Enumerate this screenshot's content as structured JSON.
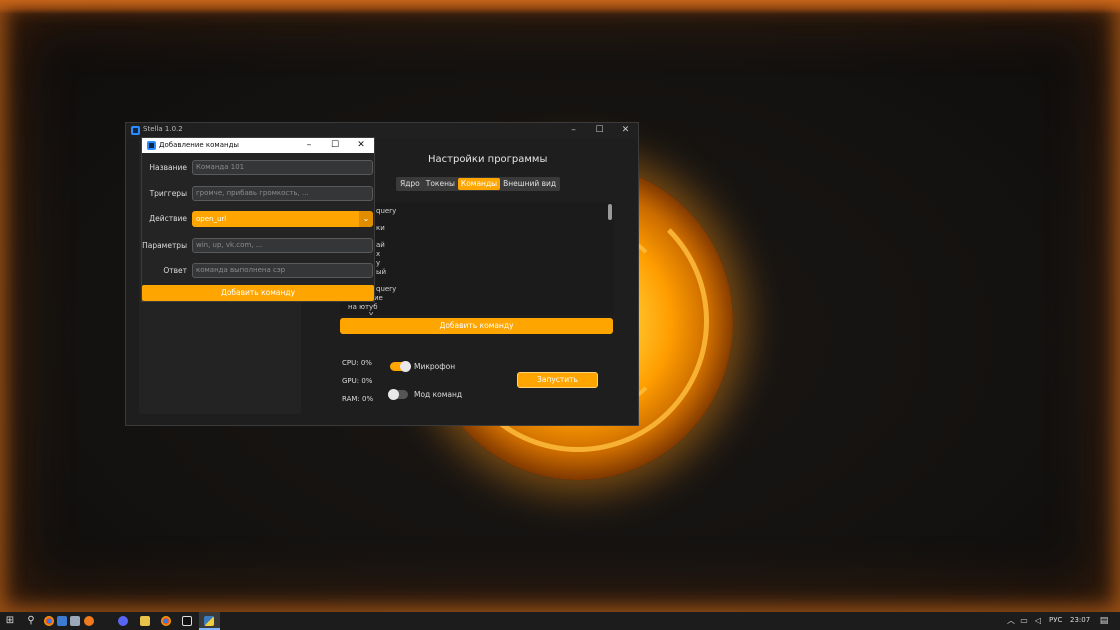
{
  "main_window": {
    "title": "Stella 1.0.2",
    "settings_title": "Настройки программы",
    "tabs": [
      {
        "label": "Ядро",
        "active": false
      },
      {
        "label": "Токены",
        "active": false
      },
      {
        "label": "Команды",
        "active": true
      },
      {
        "label": "Внешний вид",
        "active": false
      }
    ],
    "command_list_visible_fragments": [
      "query",
      "ки",
      "ай",
      "х",
      "у",
      "ый",
      "query",
      "ие",
      "на ютуб",
      "у"
    ],
    "add_command_label": "Добавить команду",
    "stats": {
      "cpu": "CPU: 0%",
      "gpu": "GPU: 0%",
      "ram": "RAM: 0%"
    },
    "microphone": {
      "label": "Микрофон",
      "on": true
    },
    "command_mode": {
      "label": "Мод команд",
      "on": false
    },
    "run_label": "Запустить"
  },
  "dialog": {
    "title": "Добавление команды",
    "fields": {
      "name": {
        "label": "Название",
        "placeholder": "Команда 101"
      },
      "triggers": {
        "label": "Триггеры",
        "placeholder": "громче, прибавь громкость, ..."
      },
      "action": {
        "label": "Действие",
        "value": "open_url"
      },
      "params": {
        "label": "Параметры",
        "placeholder": "win, up, vk.com, ..."
      },
      "answer": {
        "label": "Ответ",
        "placeholder": "команда выполнена сэр"
      }
    },
    "add_command_label": "Добавить команду"
  },
  "taskbar": {
    "language": "РУС",
    "time": "23:07",
    "apps": [
      "start-icon",
      "search-icon",
      "chrome-icon",
      "monitor-icon",
      "file-icon",
      "firefox-icon",
      "discord-icon",
      "explorer-icon",
      "chrome-icon",
      "pycharm-icon",
      "python-icon"
    ]
  },
  "colors": {
    "accent": "#ffa500",
    "window_bg": "#1e1e1e",
    "input_bg": "#343638"
  }
}
